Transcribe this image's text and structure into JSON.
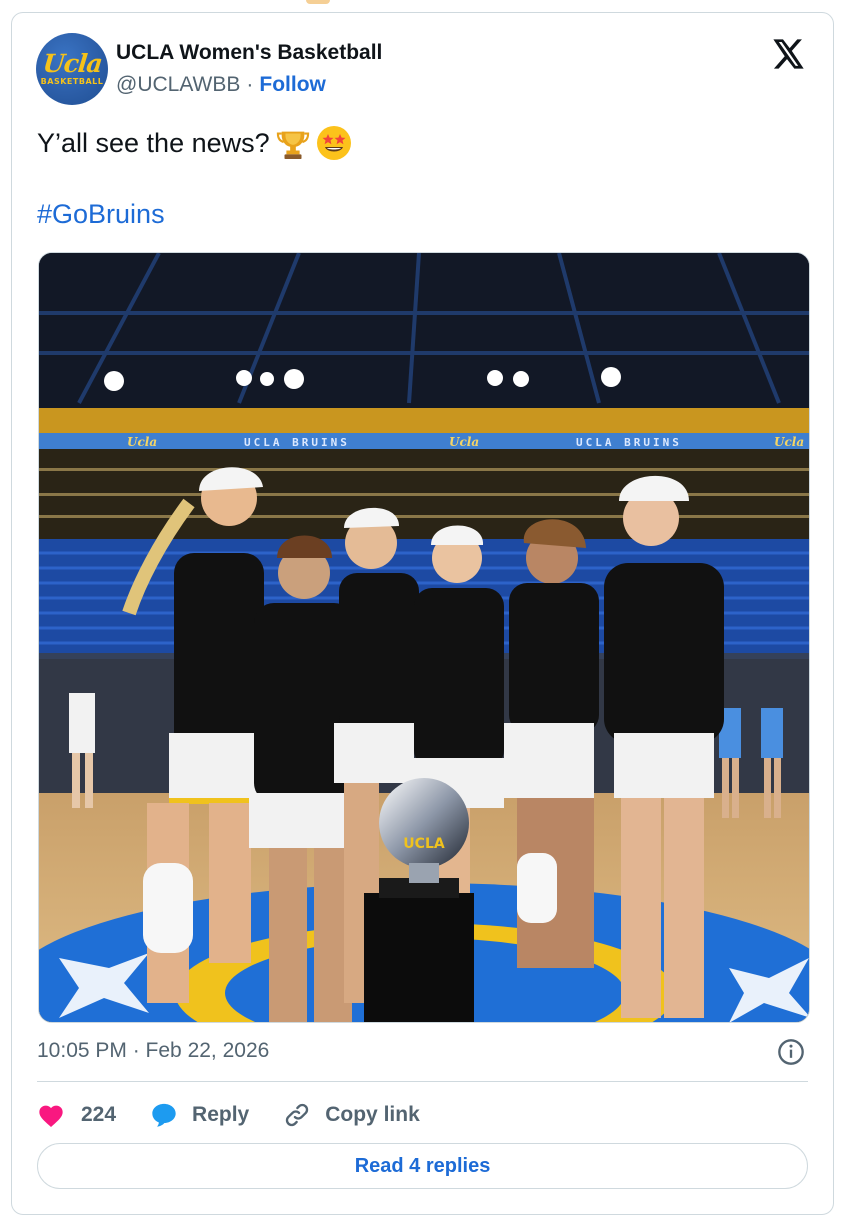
{
  "author": {
    "display_name": "UCLA Women's Basketball",
    "handle": "@UCLAWBB",
    "separator": "·",
    "follow_label": "Follow",
    "avatar_logo_text": "Ucla",
    "avatar_logo_subtext": "BASKETBALL"
  },
  "platform_icon": "x-logo-icon",
  "tweet": {
    "text": "Y’all see the news?",
    "emojis": [
      "trophy-emoji",
      "star-struck-emoji"
    ],
    "hashtag": "#GoBruins"
  },
  "media": {
    "banner_texts": [
      "Ucla",
      "UCLA BRUINS",
      "Ucla",
      "UCLA BRUINS",
      "Ucla"
    ],
    "trophy_label": "UCLA"
  },
  "meta": {
    "timestamp": "10:05 PM · Feb 22, 2026"
  },
  "actions": {
    "like_count": "224",
    "reply_label": "Reply",
    "copy_link_label": "Copy link"
  },
  "read_replies_label": "Read 4 replies",
  "colors": {
    "link_blue": "#1d6bd6",
    "muted_text": "#536471",
    "like_pink": "#f91880",
    "reply_blue": "#1d9bf0",
    "border": "#cfd9de"
  }
}
